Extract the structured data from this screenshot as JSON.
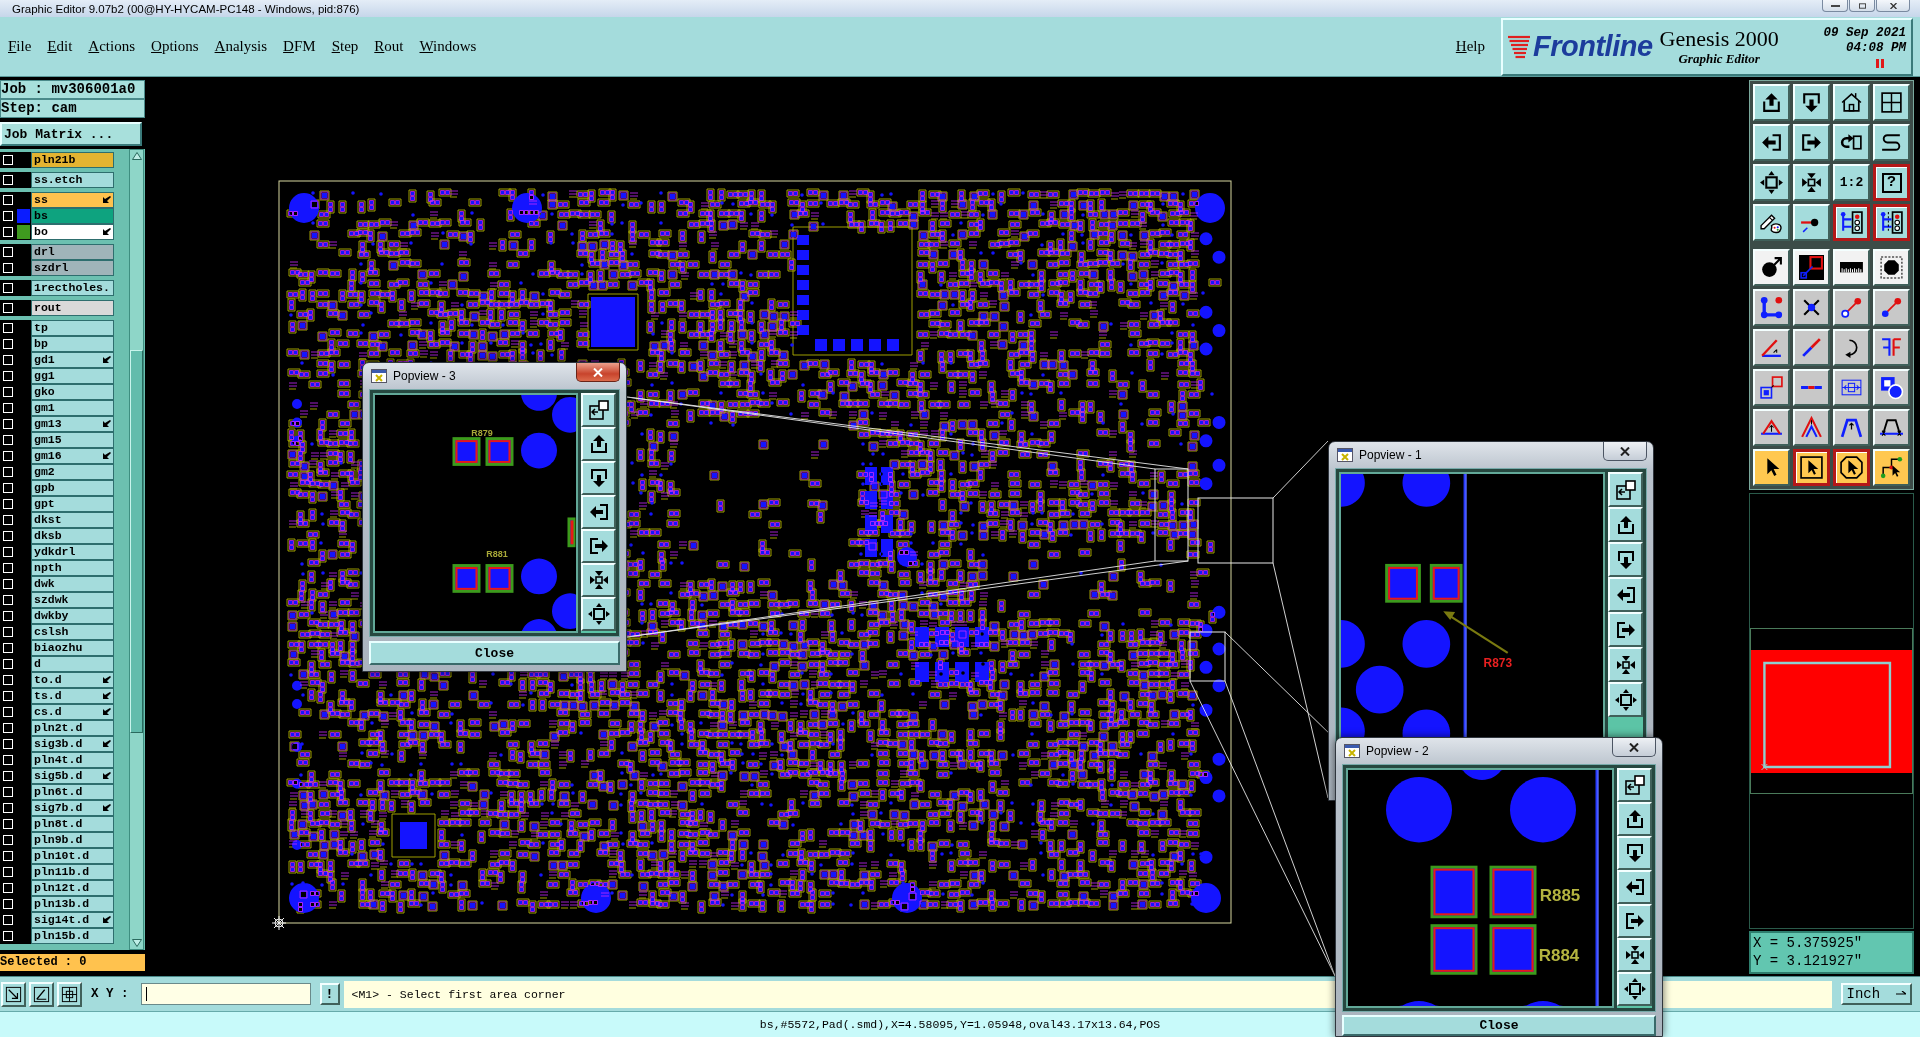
{
  "window": {
    "title": "Graphic Editor 9.07b2 (00@HY-HYCAM-PC148 - Windows, pid:876)"
  },
  "menu": [
    "File",
    "Edit",
    "Actions",
    "Options",
    "Analysis",
    "DFM",
    "Step",
    "Rout",
    "Windows"
  ],
  "help": "Help",
  "brand": {
    "logo": "Frontline",
    "product": "Genesis 2000",
    "subtitle": "Graphic Editor",
    "date": "09 Sep 2021",
    "time": "04:08 PM"
  },
  "job_panel": {
    "job": "Job : mv306001a0",
    "step": "Step: cam",
    "matrix_button": "Job Matrix ..."
  },
  "layer_groups": [
    {
      "layers": [
        {
          "name": "pln21b",
          "color": "#e4b431",
          "checked": false,
          "arrow": false
        }
      ]
    },
    {
      "layers": [
        {
          "name": "ss.etch",
          "color": "#a4dcdc",
          "checked": false,
          "arrow": false
        }
      ]
    },
    {
      "layers": [
        {
          "name": "ss",
          "color": "#ffc24e",
          "checked": false,
          "arrow": true
        },
        {
          "name": "bs",
          "color": "#0ea37f",
          "swatch": {
            "color": "#0a1cff"
          },
          "checked": false,
          "arrow": false
        },
        {
          "name": "bo",
          "color": "#ffffff",
          "swatch": {
            "color": "#3f9a1f"
          },
          "checked": false,
          "arrow": true
        }
      ]
    },
    {
      "layers": [
        {
          "name": "drl",
          "color": "#a0b4b9",
          "checked": false,
          "arrow": false
        },
        {
          "name": "szdrl",
          "color": "#a0b4b9",
          "checked": false,
          "arrow": false
        }
      ]
    },
    {
      "layers": [
        {
          "name": "1rectholes.",
          "color": "#a4dcdc",
          "checked": false,
          "arrow": false
        }
      ]
    },
    {
      "layers": [
        {
          "name": "rout",
          "color": "#d9d9d9",
          "checked": false,
          "arrow": false
        }
      ]
    },
    {
      "layers": [
        {
          "name": "tp",
          "color": "#a4dcdc",
          "checked": false,
          "arrow": false
        },
        {
          "name": "bp",
          "color": "#a4dcdc",
          "checked": false,
          "arrow": false
        },
        {
          "name": "gd1",
          "color": "#a4dcdc",
          "checked": false,
          "arrow": true
        },
        {
          "name": "gg1",
          "color": "#a4dcdc",
          "checked": false,
          "arrow": false
        },
        {
          "name": "gko",
          "color": "#a4dcdc",
          "checked": false,
          "arrow": false
        },
        {
          "name": "gm1",
          "color": "#a4dcdc",
          "checked": false,
          "arrow": false
        },
        {
          "name": "gm13",
          "color": "#a4dcdc",
          "checked": false,
          "arrow": true
        },
        {
          "name": "gm15",
          "color": "#a4dcdc",
          "checked": false,
          "arrow": false
        },
        {
          "name": "gm16",
          "color": "#a4dcdc",
          "checked": false,
          "arrow": true
        },
        {
          "name": "gm2",
          "color": "#a4dcdc",
          "checked": false,
          "arrow": false
        },
        {
          "name": "gpb",
          "color": "#a4dcdc",
          "checked": false,
          "arrow": false
        },
        {
          "name": "gpt",
          "color": "#a4dcdc",
          "checked": false,
          "arrow": false
        },
        {
          "name": "dkst",
          "color": "#a4dcdc",
          "checked": false,
          "arrow": false
        },
        {
          "name": "dksb",
          "color": "#a4dcdc",
          "checked": false,
          "arrow": false
        },
        {
          "name": "ydkdrl",
          "color": "#a4dcdc",
          "checked": false,
          "arrow": false
        },
        {
          "name": "npth",
          "color": "#a4dcdc",
          "checked": false,
          "arrow": false
        },
        {
          "name": "dwk",
          "color": "#a4dcdc",
          "checked": false,
          "arrow": false
        },
        {
          "name": "szdwk",
          "color": "#a4dcdc",
          "checked": false,
          "arrow": false
        },
        {
          "name": "dwkby",
          "color": "#a4dcdc",
          "checked": false,
          "arrow": false
        },
        {
          "name": "cslsh",
          "color": "#a4dcdc",
          "checked": false,
          "arrow": false
        },
        {
          "name": "biaozhu",
          "color": "#a4dcdc",
          "checked": false,
          "arrow": false
        },
        {
          "name": "d",
          "color": "#a4dcdc",
          "checked": false,
          "arrow": false
        },
        {
          "name": "to.d",
          "color": "#a4dcdc",
          "checked": false,
          "arrow": true
        },
        {
          "name": "ts.d",
          "color": "#a4dcdc",
          "checked": false,
          "arrow": true
        },
        {
          "name": "cs.d",
          "color": "#a4dcdc",
          "checked": false,
          "arrow": true
        },
        {
          "name": "pln2t.d",
          "color": "#a4dcdc",
          "checked": false,
          "arrow": false
        },
        {
          "name": "sig3b.d",
          "color": "#a4dcdc",
          "checked": false,
          "arrow": true
        },
        {
          "name": "pln4t.d",
          "color": "#a4dcdc",
          "checked": false,
          "arrow": false
        },
        {
          "name": "sig5b.d",
          "color": "#a4dcdc",
          "checked": false,
          "arrow": true
        },
        {
          "name": "pln6t.d",
          "color": "#a4dcdc",
          "checked": false,
          "arrow": false
        },
        {
          "name": "sig7b.d",
          "color": "#a4dcdc",
          "checked": false,
          "arrow": true
        },
        {
          "name": "pln8t.d",
          "color": "#a4dcdc",
          "checked": false,
          "arrow": false
        },
        {
          "name": "pln9b.d",
          "color": "#a4dcdc",
          "checked": false,
          "arrow": false
        },
        {
          "name": "pln10t.d",
          "color": "#a4dcdc",
          "checked": false,
          "arrow": false
        },
        {
          "name": "pln11b.d",
          "color": "#a4dcdc",
          "checked": false,
          "arrow": false
        },
        {
          "name": "pln12t.d",
          "color": "#a4dcdc",
          "checked": false,
          "arrow": false
        },
        {
          "name": "pln13b.d",
          "color": "#a4dcdc",
          "checked": false,
          "arrow": false
        },
        {
          "name": "sig14t.d",
          "color": "#a4dcdc",
          "checked": false,
          "arrow": true
        },
        {
          "name": "pln15b.d",
          "color": "#a4dcdc",
          "checked": false,
          "arrow": false
        }
      ]
    }
  ],
  "selected_count": "Selected : 0",
  "tool_rows": [
    {
      "color": "#a4dcdc",
      "tools": [
        {
          "kind": "arrow-up-box",
          "on": false
        },
        {
          "kind": "arrow-down-box",
          "on": false
        },
        {
          "kind": "house",
          "on": false
        },
        {
          "kind": "grid-window",
          "on": false
        }
      ]
    },
    {
      "color": "#a4dcdc",
      "tools": [
        {
          "kind": "arrow-left-box",
          "on": false
        },
        {
          "kind": "arrow-right-box",
          "on": false
        },
        {
          "kind": "undo-box",
          "on": false
        },
        {
          "kind": "s-curve",
          "on": false
        }
      ]
    },
    {
      "color": "#a4dcdc",
      "tools": [
        {
          "kind": "expand-box",
          "on": false
        },
        {
          "kind": "shrink-box",
          "on": false
        },
        {
          "kind": "text",
          "label": "1:2",
          "on": false
        },
        {
          "kind": "framed-text",
          "label": "?",
          "on": true
        }
      ]
    },
    {
      "color": "#a4dcdc",
      "tools": [
        {
          "kind": "pencil-palette",
          "on": false
        },
        {
          "kind": "pin-line",
          "on": false
        },
        {
          "kind": "traffic-light",
          "on": true
        },
        {
          "kind": "traffic-light-cut",
          "on": true
        }
      ]
    },
    {
      "color": "#f2f2f2",
      "tools": [
        {
          "kind": "circle-arrow",
          "on": false
        },
        {
          "kind": "linked-squares",
          "on": false
        },
        {
          "kind": "ruler",
          "on": false
        },
        {
          "kind": "octagon",
          "on": false
        }
      ]
    },
    {
      "color": "#c8c8c8",
      "tools": [
        {
          "kind": "node-link",
          "on": false
        },
        {
          "kind": "cross-dot",
          "on": false
        },
        {
          "kind": "dot-link-hollow",
          "on": false
        },
        {
          "kind": "dot-link",
          "on": false
        }
      ]
    },
    {
      "color": "#c8c8c8",
      "tools": [
        {
          "kind": "angle-line",
          "on": false
        },
        {
          "kind": "slash-line",
          "on": false
        },
        {
          "kind": "arc-arrow",
          "on": false
        },
        {
          "kind": "mirror-f",
          "on": false
        }
      ]
    },
    {
      "color": "#c8c8c8",
      "tools": [
        {
          "kind": "square-pair",
          "on": false
        },
        {
          "kind": "dash-line",
          "on": false
        },
        {
          "kind": "span-measure",
          "on": false
        },
        {
          "kind": "overlap-squares",
          "on": false
        }
      ]
    },
    {
      "color": "#c8c8c8",
      "tools": [
        {
          "kind": "triangle",
          "on": false
        },
        {
          "kind": "triangle-double",
          "on": false
        },
        {
          "kind": "trapezoid",
          "on": false
        },
        {
          "kind": "trapezoid-cross",
          "on": false
        }
      ]
    },
    {
      "color": "#ffc850",
      "tools": [
        {
          "kind": "pointer",
          "on": false
        },
        {
          "kind": "pointer-box",
          "on": true
        },
        {
          "kind": "pointer-octagon",
          "on": true
        },
        {
          "kind": "pointer-route",
          "on": false
        }
      ]
    }
  ],
  "coordinates": {
    "x": "X = 5.375925\"",
    "y": "Y = 3.121927\""
  },
  "command_bar": {
    "xy_label": "X Y :",
    "apply": "!",
    "prompt": "<M1> - Select first area corner",
    "units": "Inch"
  },
  "status_line": "bs,#5572,Pad(.smd),X=4.58095,Y=1.05948,oval43.17x13.64,POS",
  "popviews": [
    {
      "title": "Popview - 3",
      "active": true,
      "close": "Close",
      "labels": [
        {
          "text": "R879"
        },
        {
          "text": "R881"
        }
      ]
    },
    {
      "title": "Popview - 1",
      "active": false,
      "labels": [
        {
          "text": "R873"
        }
      ]
    },
    {
      "title": "Popview - 2",
      "active": false,
      "close": "Close",
      "labels": [
        {
          "text": "R885"
        },
        {
          "text": "R884"
        }
      ]
    }
  ]
}
